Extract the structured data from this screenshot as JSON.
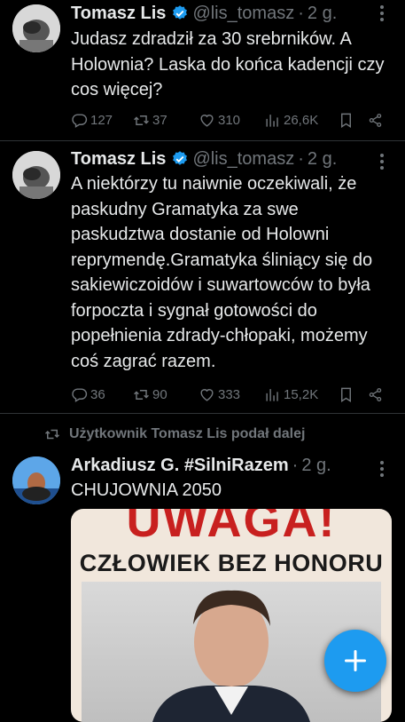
{
  "tweets": [
    {
      "name": "Tomasz Lis",
      "handle": "@lis_tomasz",
      "time": "2 g.",
      "text": "Judasz zdradził za 30 srebrników. A Holownia? Laska do końca  kadencji czy cos więcej?",
      "replies": "127",
      "retweets": "37",
      "likes": "310",
      "views": "26,6K"
    },
    {
      "name": "Tomasz Lis",
      "handle": "@lis_tomasz",
      "time": "2 g.",
      "text": "A niektórzy tu naiwnie oczekiwali, że paskudny Gramatyka za swe paskudztwa dostanie od Holowni reprymendę.Gramatyka śliniący się do sakiewiczoidów i suwartowców to była forpoczta i sygnał gotowości do popełnienia zdrady-chłopaki, możemy coś zagrać razem.",
      "replies": "36",
      "retweets": "90",
      "likes": "333",
      "views": "15,2K"
    },
    {
      "retweet_label": "Użytkownik Tomasz Lis podał dalej",
      "name": "Arkadiusz G. #SilniRazem",
      "time": "2 g.",
      "text": "CHUJOWNIA 2050",
      "image_title": "UWAGA!",
      "image_subtitle": "CZŁOWIEK BEZ HONORU"
    }
  ],
  "colors": {
    "background": "#000000",
    "text": "#e7e9ea",
    "muted": "#71767b",
    "accent": "#1d9bf0",
    "separator": "#2f3336"
  },
  "icons": [
    "reply-icon",
    "retweet-icon",
    "like-icon",
    "views-icon",
    "bookmark-icon",
    "share-icon",
    "verified-icon",
    "more-icon",
    "compose-icon"
  ]
}
